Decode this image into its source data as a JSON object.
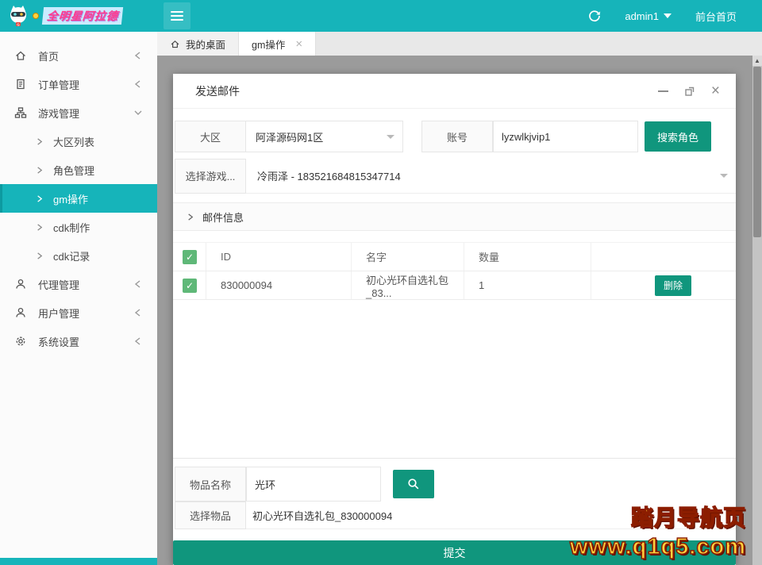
{
  "header": {
    "logo_text": "全明星阿拉德",
    "username": "admin1",
    "home_link": "前台首页"
  },
  "tabs": {
    "desktop": "我的桌面",
    "gm": "gm操作"
  },
  "sidebar": {
    "items": [
      {
        "label": "首页"
      },
      {
        "label": "订单管理"
      },
      {
        "label": "游戏管理"
      },
      {
        "label": "大区列表"
      },
      {
        "label": "角色管理"
      },
      {
        "label": "gm操作"
      },
      {
        "label": "cdk制作"
      },
      {
        "label": "cdk记录"
      },
      {
        "label": "代理管理"
      },
      {
        "label": "用户管理"
      },
      {
        "label": "系统设置"
      }
    ]
  },
  "modal": {
    "title": "发送邮件",
    "region_label": "大区",
    "region_value": "阿泽源码网1区",
    "account_label": "账号",
    "account_value": "lyzwlkjvip1",
    "search_role_button": "搜索角色",
    "game_label": "选择游戏...",
    "game_value": "冷雨泽 - 183521684815347714",
    "mail_info_label": "邮件信息",
    "table": {
      "columns": [
        "ID",
        "名字",
        "数量"
      ],
      "rows": [
        {
          "id": "830000094",
          "name": "初心光环自选礼包_83...",
          "qty": "1",
          "delete_label": "删除"
        }
      ]
    },
    "item_name_label": "物品名称",
    "item_name_value": "光环",
    "select_item_label": "选择物品",
    "select_item_value": "初心光环自选礼包_830000094",
    "submit_label": "提交"
  },
  "watermark": {
    "line1": "踏月导航页",
    "line2": "www.q1q5.com"
  },
  "colors": {
    "topbar_teal": "#16b4ba",
    "button_green": "#10967d",
    "checkbox_green": "#5fb878",
    "overlay_gray": "#9b9b9b",
    "watermark_yellow": "#ffd23e"
  }
}
